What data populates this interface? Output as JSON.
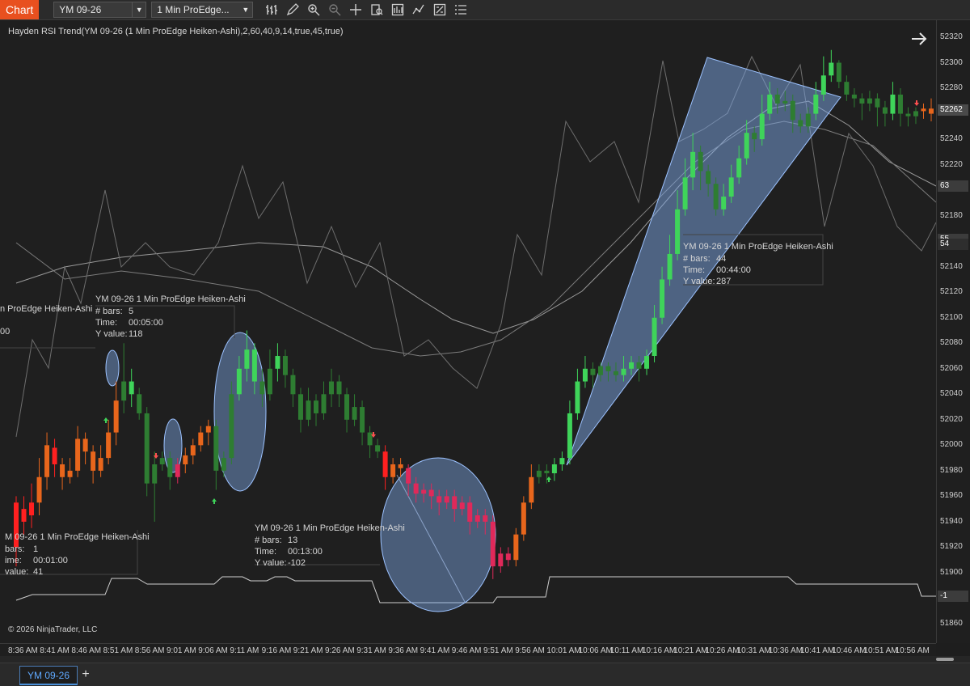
{
  "toolbar": {
    "app_tab": "Chart",
    "instrument": "YM 09-26",
    "bar_type": "1 Min ProEdge...",
    "icons": [
      "bar-style-icon",
      "draw-pencil-icon",
      "zoom-in-icon",
      "zoom-out-icon",
      "crosshair-icon",
      "data-box-icon",
      "chart-trader-icon",
      "indicators-icon",
      "strategies-icon",
      "properties-icon"
    ]
  },
  "indicator_label": "Hayden RSI Trend(YM 09-26 (1 Min ProEdge Heiken-Ashi),2,60,40,9,14,true,45,true)",
  "copyright": "© 2026 NinjaTrader, LLC",
  "info_boxes": [
    {
      "title": "n ProEdge Heiken-Ashi",
      "k1": "",
      "v1": "",
      "k2": "",
      "v2": "",
      "k3": "00",
      "v3": ""
    },
    {
      "title": "YM 09-26 1 Min ProEdge Heiken-Ashi",
      "k1": "# bars:",
      "v1": "5",
      "k2": "Time:",
      "v2": "00:05:00",
      "k3": "Y value:",
      "v3": "118"
    },
    {
      "title": "M 09-26 1 Min ProEdge Heiken-Ashi",
      "k1": "bars:",
      "v1": "1",
      "k2": "ime:",
      "v2": "00:01:00",
      "k3": "value:",
      "v3": "41"
    },
    {
      "title": "YM 09-26 1 Min ProEdge Heiken-Ashi",
      "k1": "# bars:",
      "v1": "13",
      "k2": "Time:",
      "v2": "00:13:00",
      "k3": "Y value:",
      "v3": "-102"
    },
    {
      "title": "YM 09-26 1 Min ProEdge Heiken-Ashi",
      "k1": "# bars:",
      "v1": "44",
      "k2": "Time:",
      "v2": "00:44:00",
      "k3": "Y value:",
      "v3": "287"
    }
  ],
  "price_axis": {
    "ticks": [
      "52320",
      "52300",
      "52280",
      "52260",
      "52240",
      "52220",
      "52200",
      "52180",
      "52160",
      "52140",
      "52120",
      "52100",
      "52080",
      "52060",
      "52040",
      "52020",
      "52000",
      "51980",
      "51960",
      "51940",
      "51920",
      "51900",
      "51880",
      "51860"
    ],
    "current_price": "52262",
    "tags": [
      "63",
      "55",
      "54",
      "-1"
    ]
  },
  "time_axis": [
    "8:36 AM",
    "8:41 AM",
    "8:46 AM",
    "8:51 AM",
    "8:56 AM",
    "9:01 AM",
    "9:06 AM",
    "9:11 AM",
    "9:16 AM",
    "9:21 AM",
    "9:26 AM",
    "9:31 AM",
    "9:36 AM",
    "9:41 AM",
    "9:46 AM",
    "9:51 AM",
    "9:56 AM",
    "10:01 AM",
    "10:06 AM",
    "10:11 AM",
    "10:16 AM",
    "10:21 AM",
    "10:26 AM",
    "10:31 AM",
    "10:36 AM",
    "10:41 AM",
    "10:46 AM",
    "10:51 AM",
    "10:56 AM"
  ],
  "bottom_tabs": {
    "active": "YM 09-26",
    "add": "+"
  },
  "colors": {
    "bull_strong": "#3fd45a",
    "bull_weak": "#2e7d32",
    "bear_strong": "#ff1e1e",
    "bear_weak": "#e8661c",
    "bear_pink": "#e0295a",
    "shape_fill": "#7ea8e6",
    "app_tab": "#e8501f"
  },
  "chart_data": {
    "type": "candlestick",
    "instrument": "YM 09-26",
    "bar_type": "1 Min ProEdge Heiken-Ashi",
    "ylim": [
      51850,
      52330
    ],
    "x_range": [
      "8:34 AM",
      "10:59 AM"
    ],
    "candles": [
      [
        51920,
        51955,
        51905,
        51960,
        "bs"
      ],
      [
        51950,
        51940,
        51930,
        51960,
        "bs"
      ],
      [
        51945,
        51955,
        51935,
        51970,
        "bs"
      ],
      [
        51955,
        51975,
        51945,
        51990,
        "bw"
      ],
      [
        51975,
        52000,
        51965,
        52010,
        "bw"
      ],
      [
        51998,
        51985,
        51975,
        52005,
        "bs"
      ],
      [
        51985,
        51975,
        51965,
        51990,
        "bw"
      ],
      [
        51975,
        51980,
        51970,
        51990,
        "bw"
      ],
      [
        51980,
        52005,
        51975,
        52015,
        "bw"
      ],
      [
        52005,
        51995,
        51985,
        52010,
        "bw"
      ],
      [
        51995,
        51980,
        51970,
        52000,
        "bw"
      ],
      [
        51980,
        51990,
        51975,
        52000,
        "bw"
      ],
      [
        51990,
        52010,
        51985,
        52020,
        "bw"
      ],
      [
        52010,
        52035,
        52000,
        52050,
        "bw"
      ],
      [
        52035,
        52050,
        52025,
        52080,
        "gw"
      ],
      [
        52050,
        52040,
        52030,
        52060,
        "gs"
      ],
      [
        52040,
        52025,
        52020,
        52045,
        "gw"
      ],
      [
        52025,
        51970,
        51960,
        52030,
        "gw"
      ],
      [
        51970,
        51985,
        51940,
        51995,
        "gw"
      ],
      [
        51985,
        51990,
        51980,
        51995,
        "gw"
      ],
      [
        51990,
        51975,
        51965,
        51995,
        "gw"
      ],
      [
        51975,
        51985,
        51970,
        51990,
        "pk"
      ],
      [
        51985,
        51992,
        51978,
        51998,
        "bw"
      ],
      [
        51992,
        52000,
        51985,
        52005,
        "bw"
      ],
      [
        52000,
        52010,
        51995,
        52015,
        "bw"
      ],
      [
        52010,
        52015,
        52000,
        52020,
        "bw"
      ],
      [
        52015,
        51980,
        51965,
        52020,
        "gw"
      ],
      [
        51980,
        51990,
        51975,
        51995,
        "gw"
      ],
      [
        51990,
        52040,
        51985,
        52050,
        "gw"
      ],
      [
        52040,
        52060,
        52035,
        52070,
        "gs"
      ],
      [
        52060,
        52075,
        52050,
        52090,
        "gs"
      ],
      [
        52075,
        52050,
        52040,
        52080,
        "gs"
      ],
      [
        52050,
        52040,
        52030,
        52060,
        "gw"
      ],
      [
        52040,
        52060,
        52035,
        52075,
        "gw"
      ],
      [
        52060,
        52070,
        52050,
        52080,
        "gs"
      ],
      [
        52070,
        52055,
        52045,
        52075,
        "gw"
      ],
      [
        52055,
        52040,
        52030,
        52060,
        "gw"
      ],
      [
        52040,
        52020,
        52010,
        52045,
        "gw"
      ],
      [
        52020,
        52035,
        52015,
        52045,
        "gw"
      ],
      [
        52035,
        52025,
        52015,
        52040,
        "gw"
      ],
      [
        52025,
        52040,
        52020,
        52050,
        "gw"
      ],
      [
        52040,
        52050,
        52030,
        52060,
        "gw"
      ],
      [
        52050,
        52040,
        52030,
        52055,
        "gw"
      ],
      [
        52040,
        52020,
        52010,
        52045,
        "gw"
      ],
      [
        52020,
        52030,
        52015,
        52040,
        "gw"
      ],
      [
        52030,
        52010,
        52000,
        52035,
        "gw"
      ],
      [
        52010,
        52000,
        51990,
        52015,
        "gw"
      ],
      [
        52000,
        51995,
        51990,
        52005,
        "gw"
      ],
      [
        51995,
        51975,
        51965,
        52000,
        "bs"
      ],
      [
        51975,
        51985,
        51970,
        51990,
        "bw"
      ],
      [
        51985,
        51982,
        51975,
        51990,
        "bw"
      ],
      [
        51982,
        51970,
        51960,
        51985,
        "pk"
      ],
      [
        51970,
        51962,
        51955,
        51975,
        "pk"
      ],
      [
        51962,
        51965,
        51955,
        51970,
        "pk"
      ],
      [
        51965,
        51960,
        51950,
        51970,
        "pk"
      ],
      [
        51960,
        51955,
        51945,
        51965,
        "pk"
      ],
      [
        51955,
        51960,
        51950,
        51965,
        "pk"
      ],
      [
        51960,
        51950,
        51940,
        51965,
        "pk"
      ],
      [
        51950,
        51955,
        51945,
        51960,
        "pk"
      ],
      [
        51955,
        51940,
        51930,
        51960,
        "pk"
      ],
      [
        51940,
        51945,
        51935,
        51950,
        "pk"
      ],
      [
        51945,
        51940,
        51930,
        51950,
        "pk"
      ],
      [
        51940,
        51905,
        51895,
        51945,
        "pk"
      ],
      [
        51905,
        51915,
        51900,
        51920,
        "pk"
      ],
      [
        51915,
        51910,
        51905,
        51920,
        "pk"
      ],
      [
        51910,
        51930,
        51905,
        51935,
        "bw"
      ],
      [
        51930,
        51955,
        51925,
        51960,
        "bw"
      ],
      [
        51955,
        51975,
        51950,
        51985,
        "bw"
      ],
      [
        51975,
        51980,
        51970,
        51985,
        "gw"
      ],
      [
        51980,
        51978,
        51970,
        51985,
        "gw"
      ],
      [
        51978,
        51985,
        51972,
        51990,
        "gs"
      ],
      [
        51985,
        51990,
        51980,
        51995,
        "gs"
      ],
      [
        51990,
        52025,
        51985,
        52035,
        "gs"
      ],
      [
        52025,
        52050,
        52020,
        52060,
        "gs"
      ],
      [
        52050,
        52060,
        52045,
        52070,
        "gs"
      ],
      [
        52060,
        52055,
        52045,
        52065,
        "gw"
      ],
      [
        52055,
        52062,
        52050,
        52065,
        "gw"
      ],
      [
        52062,
        52058,
        52050,
        52065,
        "gw"
      ],
      [
        52058,
        52055,
        52050,
        52065,
        "gw"
      ],
      [
        52055,
        52060,
        52050,
        52070,
        "gs"
      ],
      [
        52060,
        52065,
        52055,
        52070,
        "gs"
      ],
      [
        52065,
        52060,
        52050,
        52070,
        "gw"
      ],
      [
        52060,
        52070,
        52055,
        52075,
        "gs"
      ],
      [
        52070,
        52100,
        52065,
        52110,
        "gs"
      ],
      [
        52100,
        52130,
        52095,
        52140,
        "gs"
      ],
      [
        52130,
        52150,
        52125,
        52165,
        "gs"
      ],
      [
        52150,
        52185,
        52145,
        52200,
        "gs"
      ],
      [
        52185,
        52210,
        52180,
        52225,
        "gs"
      ],
      [
        52210,
        52230,
        52200,
        52245,
        "gs"
      ],
      [
        52230,
        52215,
        52200,
        52235,
        "gw"
      ],
      [
        52215,
        52205,
        52195,
        52220,
        "gw"
      ],
      [
        52205,
        52185,
        52180,
        52210,
        "gw"
      ],
      [
        52185,
        52195,
        52180,
        52205,
        "gs"
      ],
      [
        52195,
        52210,
        52190,
        52220,
        "gs"
      ],
      [
        52210,
        52225,
        52205,
        52235,
        "gs"
      ],
      [
        52225,
        52245,
        52220,
        52255,
        "gs"
      ],
      [
        52245,
        52240,
        52230,
        52250,
        "gw"
      ],
      [
        52240,
        52260,
        52235,
        52275,
        "gs"
      ],
      [
        52260,
        52275,
        52255,
        52285,
        "gs"
      ],
      [
        52275,
        52268,
        52260,
        52280,
        "gw"
      ],
      [
        52268,
        52270,
        52262,
        52278,
        "gw"
      ],
      [
        52270,
        52255,
        52245,
        52275,
        "gw"
      ],
      [
        52255,
        52250,
        52245,
        52260,
        "gw"
      ],
      [
        52250,
        52260,
        52245,
        52265,
        "gw"
      ],
      [
        52260,
        52275,
        52255,
        52285,
        "gs"
      ],
      [
        52275,
        52290,
        52270,
        52305,
        "gs"
      ],
      [
        52290,
        52300,
        52285,
        52310,
        "gs"
      ],
      [
        52300,
        52285,
        52280,
        52302,
        "gw"
      ],
      [
        52285,
        52275,
        52270,
        52290,
        "gw"
      ],
      [
        52275,
        52272,
        52265,
        52280,
        "gw"
      ],
      [
        52272,
        52268,
        52255,
        52276,
        "gw"
      ],
      [
        52268,
        52272,
        52262,
        52278,
        "gw"
      ],
      [
        52272,
        52265,
        52250,
        52276,
        "gw"
      ],
      [
        52265,
        52260,
        52250,
        52270,
        "gw"
      ],
      [
        52260,
        52275,
        52255,
        52285,
        "gs"
      ],
      [
        52275,
        52260,
        52250,
        52280,
        "gw"
      ],
      [
        52260,
        52258,
        52250,
        52265,
        "gw"
      ],
      [
        52258,
        52262,
        52252,
        52265,
        "gw"
      ],
      [
        52262,
        52264,
        52256,
        52268,
        "bw"
      ],
      [
        52264,
        52260,
        52254,
        52272,
        "bw"
      ]
    ]
  }
}
